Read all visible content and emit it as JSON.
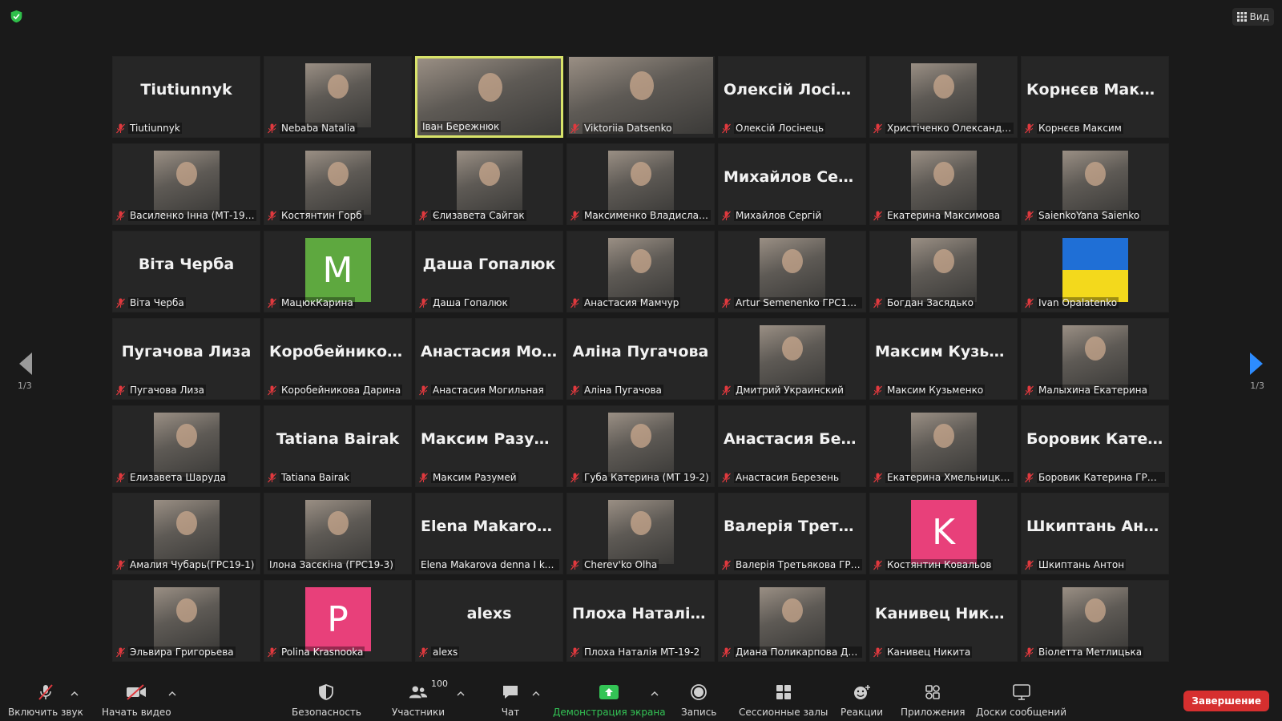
{
  "top": {
    "view_label": "Вид",
    "shield_icon": "shield-check-icon"
  },
  "pagination": {
    "left": "1/3",
    "right": "1/3"
  },
  "tiles": [
    {
      "type": "text",
      "big": "Tiutiunnyk",
      "label": "Tiutiunnyk",
      "muted": true
    },
    {
      "type": "photo",
      "label": "Nebaba Natalia",
      "muted": true
    },
    {
      "type": "video",
      "label": "Іван Бережнюк",
      "muted": false,
      "active": true
    },
    {
      "type": "video",
      "label": "Viktoriia Datsenko",
      "muted": true
    },
    {
      "type": "text",
      "big": "Олексій Лосіне...",
      "label": "Олексій Лосінець",
      "muted": true
    },
    {
      "type": "photo",
      "label": "Христіченко Олександр ...",
      "muted": true
    },
    {
      "type": "text",
      "big": "Корнєєв Максим",
      "label": "Корнєєв Максим",
      "muted": true
    },
    {
      "type": "photo",
      "label": "Василенко Інна (МТ-19-2)",
      "muted": true
    },
    {
      "type": "photo",
      "label": "Костянтин Горб",
      "muted": true
    },
    {
      "type": "photo",
      "label": "Єлизавета Сайгак",
      "muted": true
    },
    {
      "type": "photo",
      "label": "Максименко Владислав ...",
      "muted": true
    },
    {
      "type": "text",
      "big": "Михайлов Сергій",
      "label": "Михайлов Сергій",
      "muted": true
    },
    {
      "type": "photo",
      "label": "Екатерина Максимова",
      "muted": true
    },
    {
      "type": "photo",
      "label": "SaienkoYana Saienko",
      "muted": true
    },
    {
      "type": "text",
      "big": "Віта Черба",
      "label": "Віта Черба",
      "muted": true
    },
    {
      "type": "avatar",
      "letter": "M",
      "color": "#5ea83f",
      "label": "МацюкКарина",
      "muted": true
    },
    {
      "type": "text",
      "big": "Даша Гопалюк",
      "label": "Даша Гопалюк",
      "muted": true
    },
    {
      "type": "photo",
      "label": "Анастасия Мамчур",
      "muted": true
    },
    {
      "type": "photo",
      "label": "Artur Semenenko ГРС19-1",
      "muted": true
    },
    {
      "type": "photo",
      "label": "Богдан Засядько",
      "muted": true
    },
    {
      "type": "flag",
      "label": "Ivan Opalatenko",
      "muted": true
    },
    {
      "type": "text",
      "big": "Пугачова Лиза",
      "label": "Пугачова Лиза",
      "muted": true
    },
    {
      "type": "text",
      "big": "Коробейников...",
      "label": "Коробейникова Дарина",
      "muted": true
    },
    {
      "type": "text",
      "big": "Анастасия Мог...",
      "label": "Анастасия Могильная",
      "muted": true
    },
    {
      "type": "text",
      "big": "Аліна Пугачова",
      "label": "Аліна Пугачова",
      "muted": true
    },
    {
      "type": "photo",
      "label": "Дмитрий Украинский",
      "muted": true
    },
    {
      "type": "text",
      "big": "Максим Кузьм...",
      "label": "Максим Кузьменко",
      "muted": true
    },
    {
      "type": "photo",
      "label": "Малыхина Екатерина",
      "muted": true
    },
    {
      "type": "photo",
      "label": "Елизавета Шаруда",
      "muted": true
    },
    {
      "type": "text",
      "big": "Tatiana Bairak",
      "label": "Tatiana Bairak",
      "muted": true
    },
    {
      "type": "text",
      "big": "Максим Разумей",
      "label": "Максим Разумей",
      "muted": true
    },
    {
      "type": "photo",
      "label": "Губа Катерина (МТ 19-2)",
      "muted": true
    },
    {
      "type": "text",
      "big": "Анастасия Бере...",
      "label": "Анастасия Березень",
      "muted": true
    },
    {
      "type": "photo",
      "label": "Екатерина Хмельницкая",
      "muted": true
    },
    {
      "type": "text",
      "big": "Боровик Катер...",
      "label": "Боровик Катерина ГРС1...",
      "muted": true
    },
    {
      "type": "photo",
      "label": "Амалия Чубарь(ГРС19-1)",
      "muted": true
    },
    {
      "type": "photo",
      "label": "Ілона Засєкіна (ГРС19-3)",
      "muted": false
    },
    {
      "type": "text",
      "big": "Elena Makarova...",
      "label": "Elena Makarova denna I kurs",
      "muted": false
    },
    {
      "type": "photo",
      "label": "Cherev'ko Olha",
      "muted": true
    },
    {
      "type": "text",
      "big": "Валерія Третья...",
      "label": "Валерія Третьякова ГРС1...",
      "muted": true
    },
    {
      "type": "avatar",
      "letter": "K",
      "color": "#e8407a",
      "label": "Костянтин Ковальов",
      "muted": true
    },
    {
      "type": "text",
      "big": "Шкиптань Антон",
      "label": "Шкиптань Антон",
      "muted": true
    },
    {
      "type": "photo",
      "label": "Эльвира Григорьева",
      "muted": true
    },
    {
      "type": "avatar",
      "letter": "P",
      "color": "#e8407a",
      "label": "Polina Krasnooka",
      "muted": true
    },
    {
      "type": "text",
      "big": "alexs",
      "label": "alexs",
      "muted": true
    },
    {
      "type": "text",
      "big": "Плоха Наталія...",
      "label": "Плоха Наталія МТ-19-2",
      "muted": true
    },
    {
      "type": "photo",
      "label": "Диана Поликарпова Диа...",
      "muted": true
    },
    {
      "type": "text",
      "big": "Канивец Никита",
      "label": "Канивец Никита",
      "muted": true
    },
    {
      "type": "photo",
      "label": "Віолетта Метлицька",
      "muted": true
    }
  ],
  "toolbar": {
    "unmute_label": "Включить звук",
    "start_video_label": "Начать видео",
    "security_label": "Безопасность",
    "participants_label": "Участники",
    "participants_count": "100",
    "chat_label": "Чат",
    "share_label": "Демонстрация экрана",
    "record_label": "Запись",
    "breakout_label": "Сессионные залы",
    "reactions_label": "Реакции",
    "apps_label": "Приложения",
    "whiteboards_label": "Доски сообщений",
    "end_label": "Завершение"
  },
  "colors": {
    "share_green": "#33c455",
    "end_red": "#d62f2f",
    "active_border": "#d8e36a",
    "mute_red": "#e0393e"
  }
}
